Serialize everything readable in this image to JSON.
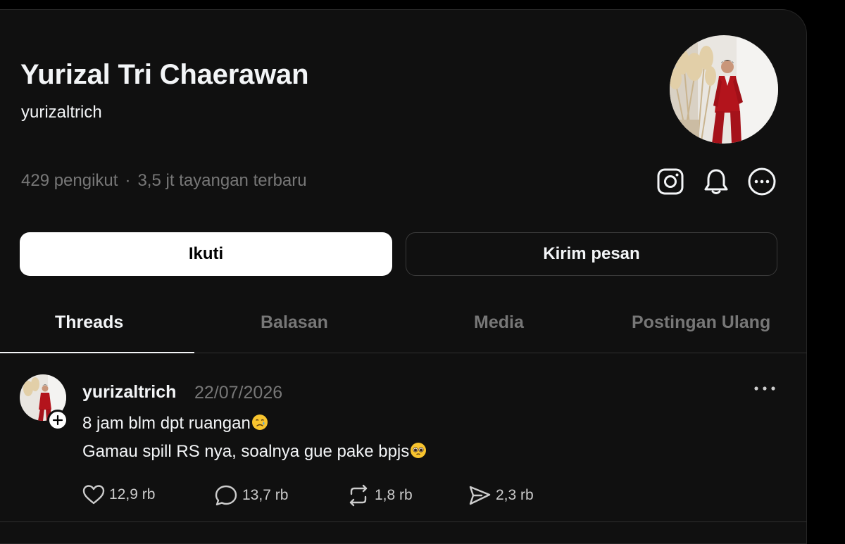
{
  "profile": {
    "name": "Yurizal Tri Chaerawan",
    "handle": "yurizaltrich",
    "followers": "429 pengikut",
    "separator": "·",
    "views": "3,5 jt tayangan terbaru"
  },
  "icons": {
    "instagram": "instagram-icon",
    "notifications": "bell-icon",
    "more": "more-circle-icon"
  },
  "buttons": {
    "follow": "Ikuti",
    "message": "Kirim pesan"
  },
  "tabs": [
    {
      "label": "Threads",
      "active": true
    },
    {
      "label": "Balasan",
      "active": false
    },
    {
      "label": "Media",
      "active": false
    },
    {
      "label": "Postingan Ulang",
      "active": false
    }
  ],
  "post": {
    "username": "yurizaltrich",
    "date": "22/07/2026",
    "lines": [
      "8 jam blm dpt ruangan",
      "Gamau spill RS nya, soalnya gue pake bpjs"
    ],
    "line_emojis": [
      "crying-face-emoji",
      "pleading-face-emoji"
    ],
    "actions": {
      "likes": "12,9 rb",
      "comments": "13,7 rb",
      "reposts": "1,8 rb",
      "shares": "2,3 rb"
    }
  },
  "colors": {
    "background": "#101010",
    "text_primary": "#f3f5f7",
    "text_secondary": "#777777",
    "suit_red": "#b3141c"
  }
}
